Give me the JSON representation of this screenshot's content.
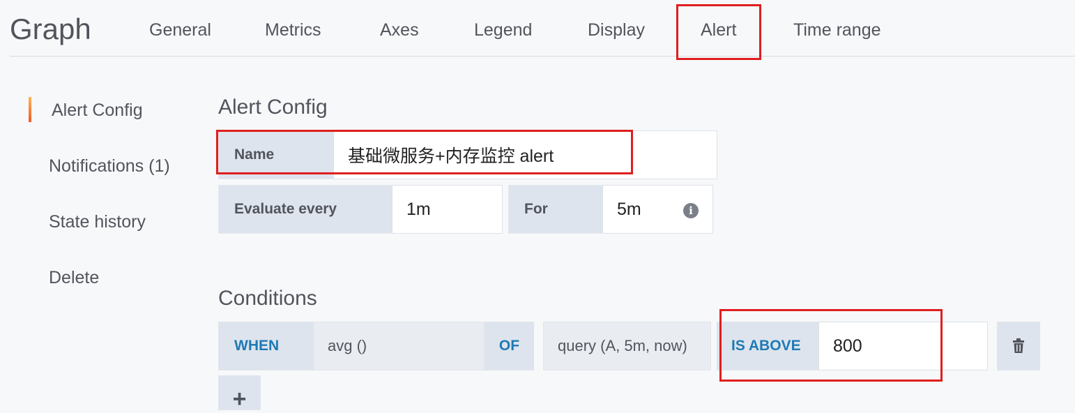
{
  "header": {
    "panel_title": "Graph",
    "tabs": [
      "General",
      "Metrics",
      "Axes",
      "Legend",
      "Display",
      "Alert",
      "Time range"
    ],
    "active_tab": "Alert"
  },
  "nav": {
    "items": [
      "Alert Config",
      "Notifications (1)",
      "State history",
      "Delete"
    ],
    "active": "Alert Config"
  },
  "alert_config": {
    "title": "Alert Config",
    "name_label": "Name",
    "name_value": "基础微服务+内存监控 alert",
    "evaluate_label": "Evaluate every",
    "evaluate_value": "1m",
    "for_label": "For",
    "for_value": "5m",
    "info_icon": "info-circle-icon"
  },
  "conditions": {
    "title": "Conditions",
    "when_label": "WHEN",
    "reducer": "avg ()",
    "of_label": "OF",
    "query": "query (A, 5m, now)",
    "evaluator": "IS ABOVE",
    "threshold": "800",
    "delete_icon": "trash-icon",
    "add_label": "+"
  },
  "colors": {
    "highlight": "#e01e1e",
    "keyword": "#1f7ab5",
    "label_bg": "#dde4ed",
    "accent_gradient_top": "#ffb357",
    "accent_gradient_bottom": "#f05a28"
  }
}
